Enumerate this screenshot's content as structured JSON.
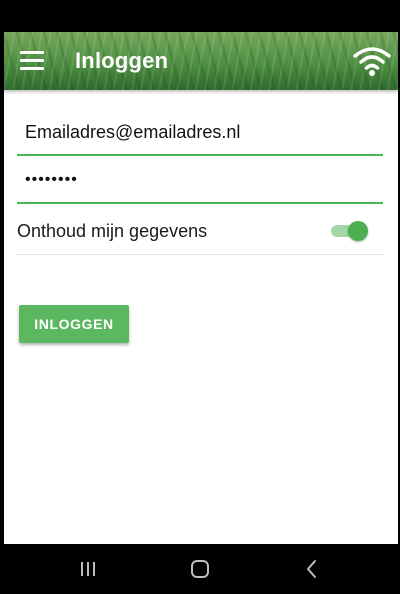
{
  "app_bar": {
    "title": "Inloggen",
    "menu_icon": "hamburger-menu-icon",
    "wifi_icon": "wifi-icon",
    "accent_color": "#4caf50"
  },
  "form": {
    "email_value": "Emailadres@emailadres.nl",
    "password_value": "••••••••",
    "remember_label": "Onthoud mijn gegevens",
    "remember_enabled": true,
    "login_label": "INLOGGEN",
    "button_color": "#5cb860"
  },
  "nav_bar": {
    "recent_icon": "recent-apps-icon",
    "home_icon": "home-icon",
    "back_icon": "back-icon"
  }
}
